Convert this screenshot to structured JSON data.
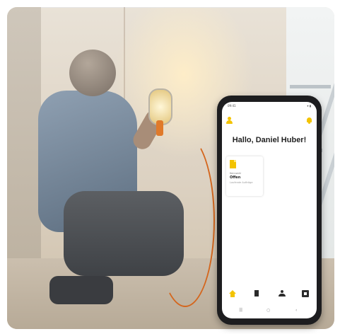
{
  "phone": {
    "status_time": "09:41",
    "status_icons": "▾ ▮",
    "greeting": "Hallo, Daniel Huber!",
    "tile": {
      "category": "Kennzahl",
      "title": "Offen",
      "subtitle": "Laufende Aufträge"
    },
    "nav_items": [
      "home-icon",
      "document-icon",
      "user-icon",
      "box-icon"
    ],
    "system_nav": {
      "menu": "☰",
      "home": "○",
      "back": "‹"
    }
  },
  "colors": {
    "accent": "#f3c300",
    "phone_frame": "#1d1d1f",
    "cable": "#d4661d"
  }
}
